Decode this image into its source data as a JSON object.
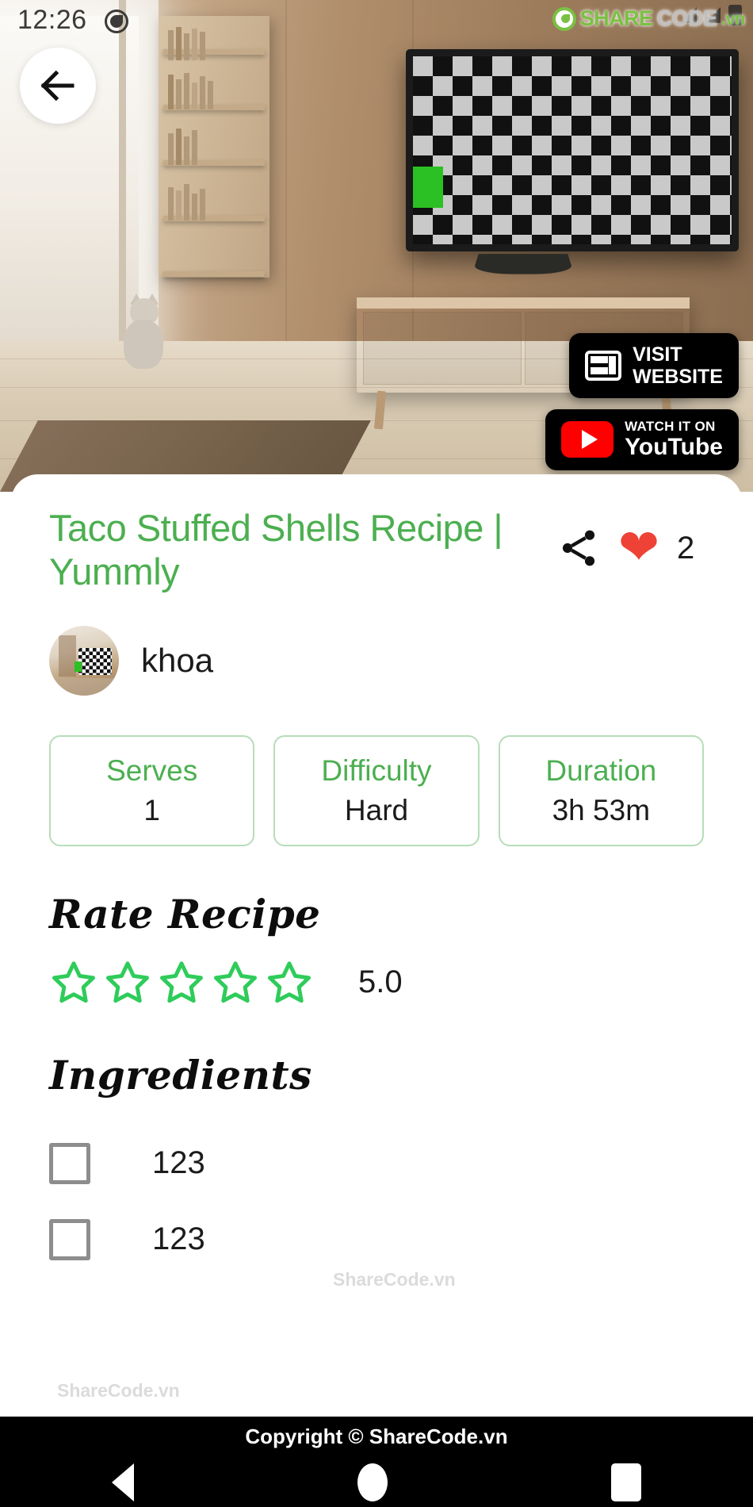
{
  "statusbar": {
    "time": "12:26",
    "dnd_icon": "do-not-disturb-icon",
    "watermark_logo": {
      "share": "SHARE",
      "code": "CODE",
      "vn": ".vn"
    }
  },
  "ar_scene": {
    "back_button_icon": "arrow-left-icon",
    "buttons": [
      {
        "icon": "website-layout-icon",
        "line1": "VISIT",
        "line2": "WEBSITE"
      },
      {
        "icon": "youtube-icon",
        "line1": "WATCH IT ON",
        "line2": "YouTube"
      }
    ]
  },
  "recipe": {
    "title": "Taco Stuffed Shells Recipe | Yummly",
    "share_icon": "share-icon",
    "favorite_icon": "heart-icon",
    "like_count": "2",
    "author": {
      "name": "khoa",
      "avatar_icon": "avatar"
    },
    "stats": [
      {
        "label": "Serves",
        "value": "1"
      },
      {
        "label": "Difficulty",
        "value": "Hard"
      },
      {
        "label": "Duration",
        "value": "3h 53m"
      }
    ],
    "rating": {
      "heading": "Rate Recipe",
      "stars": 5,
      "filled": 0,
      "value": "5.0"
    },
    "ingredients": {
      "heading": "Ingredients",
      "items": [
        {
          "label": "123",
          "checked": false
        },
        {
          "label": "123",
          "checked": false
        }
      ]
    }
  },
  "watermarks": {
    "one": "ShareCode.vn",
    "two": "ShareCode.vn"
  },
  "navbar": {
    "copyright": "Copyright © ShareCode.vn",
    "back_icon": "nav-back-icon",
    "home_icon": "nav-home-icon",
    "recents_icon": "nav-recents-icon"
  },
  "colors": {
    "accent_green": "#4caf50",
    "star_green": "#2ecc5a",
    "heart_red": "#ee4237",
    "youtube_red": "#ff0000"
  }
}
